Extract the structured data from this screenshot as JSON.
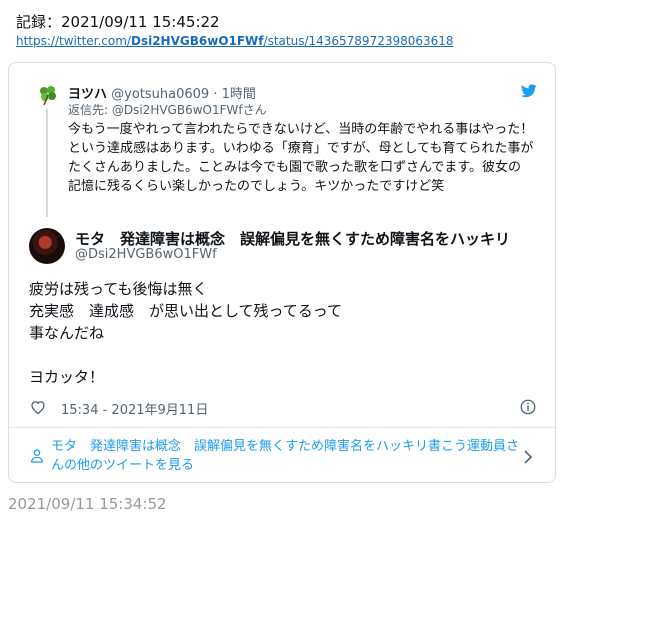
{
  "record": "記録：2021/09/11 15:45:22",
  "url": {
    "prefix": "https://twitter.com/",
    "bold": "Dsi2HVGB6wO1FWf",
    "suffix": "/status/1436578972398063618"
  },
  "reply_tweet": {
    "name": "ヨツハ",
    "handle": "@yotsuha0609",
    "time_sep": " · ",
    "time": "1時間",
    "replying_to": "返信先: @Dsi2HVGB6wO1FWfさん",
    "text": "今もう一度やれって言われたらできないけど、当時の年齢でやれる事はやった！という達成感はあります。いわゆる「療育」ですが、母としても育てられた事がたくさんありました。ことみは今でも園で歌った歌を口ずさんでます。彼女の記憶に残るくらい楽しかったのでしょう。キツかったですけど笑"
  },
  "main_tweet": {
    "name": "モタ　発達障害は概念　誤解偏見を無くすため障害名をハッキリ",
    "handle": "@Dsi2HVGB6wO1FWf",
    "lines": [
      "疲労は残っても後悔は無く",
      "充実感　達成感　が思い出として残ってるって",
      "事なんだね",
      "",
      "ヨカッタ！"
    ],
    "timestamp": "15:34 - 2021年9月11日"
  },
  "more_link": "モタ　発達障害は概念　誤解偏見を無くすため障害名をハッキリ書こう運動員さんの他のツイートを見る",
  "footer_time": "2021/09/11 15:34:52",
  "icons": [
    "clover-avatar-icon",
    "twitter-bird-icon",
    "heart-icon",
    "info-icon",
    "person-icon",
    "chevron-right-icon"
  ],
  "colors": {
    "link": "#1a6bb8",
    "twitter_blue": "#1d9bf0",
    "muted": "#536471"
  }
}
